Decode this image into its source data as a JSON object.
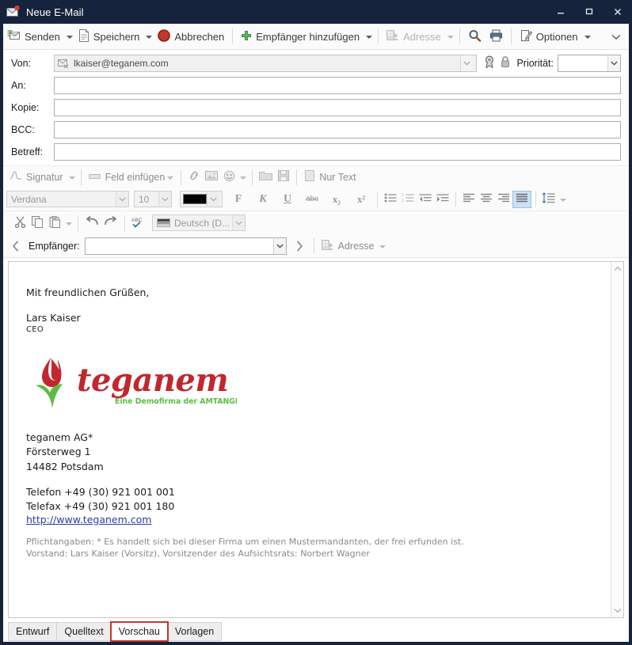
{
  "window": {
    "title": "Neue E-Mail",
    "title_icon": "new-mail-icon",
    "minimize": "–",
    "maximize": "□",
    "close": "×"
  },
  "toolbar": {
    "send": "Senden",
    "save": "Speichern",
    "cancel": "Abbrechen",
    "add_recipient": "Empfänger hinzufügen",
    "address": "Adresse",
    "search_icon": "search-icon",
    "print_icon": "print-icon",
    "options": "Optionen",
    "overflow_icon": "chevron-down-icon"
  },
  "fields": {
    "from_label": "Von:",
    "from_value": "lkaiser@teganem.com",
    "to_label": "An:",
    "to_value": "",
    "cc_label": "Kopie:",
    "cc_value": "",
    "bcc_label": "BCC:",
    "bcc_value": "",
    "subject_label": "Betreff:",
    "subject_value": "",
    "priority_label": "Priorität:",
    "priority_value": "",
    "certificate_icon": "certificate-seal-icon",
    "lock_icon": "lock-icon"
  },
  "format_toolbar_1": {
    "signature": "Signatur",
    "insert_field": "Feld einfügen",
    "link_icon": "link-icon",
    "image_icon": "image-icon",
    "emoji_icon": "smiley-icon",
    "folder_icon": "folder-icon",
    "disk_icon": "save-disk-icon",
    "plain_text": "Nur Text"
  },
  "format_toolbar_2": {
    "font_family": "Verdana",
    "font_size": "10",
    "font_color": "#000000",
    "bold": "F",
    "italic": "K",
    "underline": "U",
    "strikethrough": "abc",
    "subscript": "x₂",
    "superscript": "x²",
    "bullet_list_icon": "bulleted-list-icon",
    "number_list_icon": "numbered-list-icon",
    "outdent_icon": "decrease-indent-icon",
    "indent_icon": "increase-indent-icon",
    "align_left_icon": "align-left-icon",
    "align_center_icon": "align-center-icon",
    "align_right_icon": "align-right-icon",
    "align_justify_icon": "align-justify-icon",
    "line_spacing_icon": "line-spacing-icon"
  },
  "format_toolbar_3": {
    "cut_icon": "cut-scissors-icon",
    "copy_icon": "copy-icon",
    "paste_icon": "paste-icon",
    "undo_icon": "undo-arrow-icon",
    "redo_icon": "redo-arrow-icon",
    "spellcheck_icon": "spellcheck-abc-icon",
    "language": "Deutsch (D..."
  },
  "recipient_bar": {
    "prev_icon": "chevron-left-icon",
    "label": "Empfänger:",
    "value": "",
    "next_icon": "chevron-right-icon",
    "address": "Adresse"
  },
  "body": {
    "greeting": "Mit freundlichen Grüßen,",
    "name": "Lars Kaiser",
    "role": "CEO",
    "logo": {
      "wordmark": "teganem",
      "tagline": "Eine Demofirma der AMTANGEE AG",
      "mark_icon": "tulip-flower-icon",
      "red": "#c1272d",
      "green": "#5fbb46"
    },
    "company": "teganem AG*",
    "street": "Försterweg 1",
    "city": "14482 Potsdam",
    "phone": "Telefon +49 (30) 921 001 001",
    "fax": "Telefax  +49 (30) 921 001 180",
    "website": "http://www.teganem.com",
    "legal_1": "Pflichtangaben: * Es handelt sich bei dieser Firma um einen Mustermandanten, der frei erfunden ist.",
    "legal_2": "Vorstand: Lars Kaiser (Vorsitz), Vorsitzender des Aufsichtsrats: Norbert Wagner"
  },
  "scrollbar": {
    "up_icon": "chevron-up-icon",
    "down_icon": "chevron-down-icon"
  },
  "tabs": {
    "items": [
      {
        "label": "Entwurf",
        "active": false
      },
      {
        "label": "Quelltext",
        "active": false
      },
      {
        "label": "Vorschau",
        "active": true
      },
      {
        "label": "Vorlagen",
        "active": false
      }
    ],
    "highlight_color": "#c0392b"
  }
}
